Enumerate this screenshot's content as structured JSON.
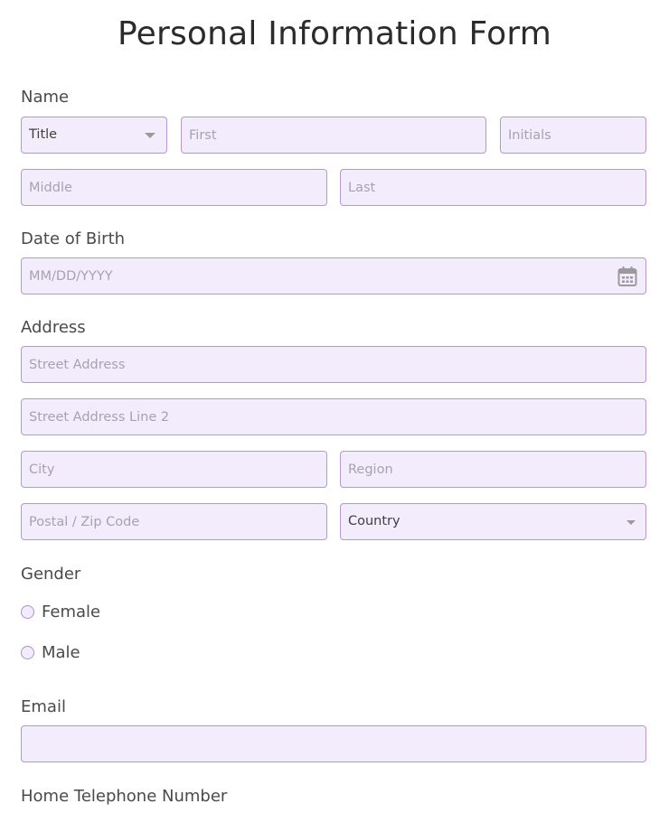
{
  "form": {
    "title": "Personal Information Form",
    "name": {
      "label": "Name",
      "title_select": "Title",
      "first_placeholder": "First",
      "initials_placeholder": "Initials",
      "middle_placeholder": "Middle",
      "last_placeholder": "Last"
    },
    "dob": {
      "label": "Date of Birth",
      "placeholder": "MM/DD/YYYY",
      "icon": "calendar-icon"
    },
    "address": {
      "label": "Address",
      "street_placeholder": "Street Address",
      "street2_placeholder": "Street Address Line 2",
      "city_placeholder": "City",
      "region_placeholder": "Region",
      "postal_placeholder": "Postal / Zip Code",
      "country_select": "Country"
    },
    "gender": {
      "label": "Gender",
      "options": [
        "Female",
        "Male"
      ]
    },
    "email": {
      "label": "Email",
      "placeholder": ""
    },
    "home_phone": {
      "label": "Home Telephone Number"
    }
  },
  "colors": {
    "field_bg": "#f3ecfd",
    "field_border": "#b896d1",
    "placeholder": "#a7a2ad"
  }
}
